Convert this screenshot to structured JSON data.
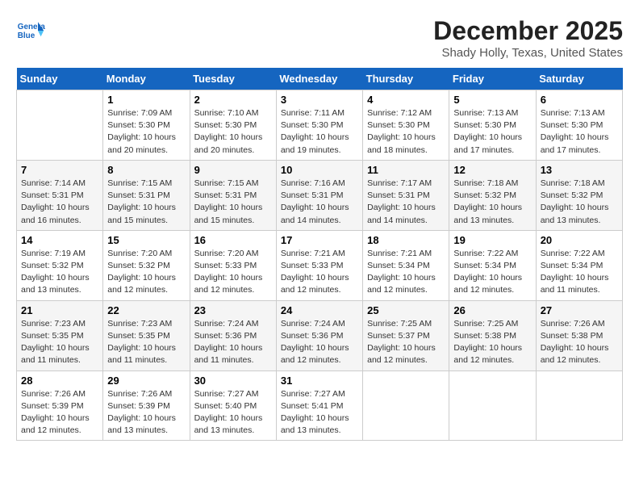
{
  "header": {
    "month": "December 2025",
    "location": "Shady Holly, Texas, United States"
  },
  "days_of_week": [
    "Sunday",
    "Monday",
    "Tuesday",
    "Wednesday",
    "Thursday",
    "Friday",
    "Saturday"
  ],
  "weeks": [
    [
      {
        "num": "",
        "info": ""
      },
      {
        "num": "1",
        "info": "Sunrise: 7:09 AM\nSunset: 5:30 PM\nDaylight: 10 hours\nand 20 minutes."
      },
      {
        "num": "2",
        "info": "Sunrise: 7:10 AM\nSunset: 5:30 PM\nDaylight: 10 hours\nand 20 minutes."
      },
      {
        "num": "3",
        "info": "Sunrise: 7:11 AM\nSunset: 5:30 PM\nDaylight: 10 hours\nand 19 minutes."
      },
      {
        "num": "4",
        "info": "Sunrise: 7:12 AM\nSunset: 5:30 PM\nDaylight: 10 hours\nand 18 minutes."
      },
      {
        "num": "5",
        "info": "Sunrise: 7:13 AM\nSunset: 5:30 PM\nDaylight: 10 hours\nand 17 minutes."
      },
      {
        "num": "6",
        "info": "Sunrise: 7:13 AM\nSunset: 5:30 PM\nDaylight: 10 hours\nand 17 minutes."
      }
    ],
    [
      {
        "num": "7",
        "info": "Sunrise: 7:14 AM\nSunset: 5:31 PM\nDaylight: 10 hours\nand 16 minutes."
      },
      {
        "num": "8",
        "info": "Sunrise: 7:15 AM\nSunset: 5:31 PM\nDaylight: 10 hours\nand 15 minutes."
      },
      {
        "num": "9",
        "info": "Sunrise: 7:15 AM\nSunset: 5:31 PM\nDaylight: 10 hours\nand 15 minutes."
      },
      {
        "num": "10",
        "info": "Sunrise: 7:16 AM\nSunset: 5:31 PM\nDaylight: 10 hours\nand 14 minutes."
      },
      {
        "num": "11",
        "info": "Sunrise: 7:17 AM\nSunset: 5:31 PM\nDaylight: 10 hours\nand 14 minutes."
      },
      {
        "num": "12",
        "info": "Sunrise: 7:18 AM\nSunset: 5:32 PM\nDaylight: 10 hours\nand 13 minutes."
      },
      {
        "num": "13",
        "info": "Sunrise: 7:18 AM\nSunset: 5:32 PM\nDaylight: 10 hours\nand 13 minutes."
      }
    ],
    [
      {
        "num": "14",
        "info": "Sunrise: 7:19 AM\nSunset: 5:32 PM\nDaylight: 10 hours\nand 13 minutes."
      },
      {
        "num": "15",
        "info": "Sunrise: 7:20 AM\nSunset: 5:32 PM\nDaylight: 10 hours\nand 12 minutes."
      },
      {
        "num": "16",
        "info": "Sunrise: 7:20 AM\nSunset: 5:33 PM\nDaylight: 10 hours\nand 12 minutes."
      },
      {
        "num": "17",
        "info": "Sunrise: 7:21 AM\nSunset: 5:33 PM\nDaylight: 10 hours\nand 12 minutes."
      },
      {
        "num": "18",
        "info": "Sunrise: 7:21 AM\nSunset: 5:34 PM\nDaylight: 10 hours\nand 12 minutes."
      },
      {
        "num": "19",
        "info": "Sunrise: 7:22 AM\nSunset: 5:34 PM\nDaylight: 10 hours\nand 12 minutes."
      },
      {
        "num": "20",
        "info": "Sunrise: 7:22 AM\nSunset: 5:34 PM\nDaylight: 10 hours\nand 11 minutes."
      }
    ],
    [
      {
        "num": "21",
        "info": "Sunrise: 7:23 AM\nSunset: 5:35 PM\nDaylight: 10 hours\nand 11 minutes."
      },
      {
        "num": "22",
        "info": "Sunrise: 7:23 AM\nSunset: 5:35 PM\nDaylight: 10 hours\nand 11 minutes."
      },
      {
        "num": "23",
        "info": "Sunrise: 7:24 AM\nSunset: 5:36 PM\nDaylight: 10 hours\nand 11 minutes."
      },
      {
        "num": "24",
        "info": "Sunrise: 7:24 AM\nSunset: 5:36 PM\nDaylight: 10 hours\nand 12 minutes."
      },
      {
        "num": "25",
        "info": "Sunrise: 7:25 AM\nSunset: 5:37 PM\nDaylight: 10 hours\nand 12 minutes."
      },
      {
        "num": "26",
        "info": "Sunrise: 7:25 AM\nSunset: 5:38 PM\nDaylight: 10 hours\nand 12 minutes."
      },
      {
        "num": "27",
        "info": "Sunrise: 7:26 AM\nSunset: 5:38 PM\nDaylight: 10 hours\nand 12 minutes."
      }
    ],
    [
      {
        "num": "28",
        "info": "Sunrise: 7:26 AM\nSunset: 5:39 PM\nDaylight: 10 hours\nand 12 minutes."
      },
      {
        "num": "29",
        "info": "Sunrise: 7:26 AM\nSunset: 5:39 PM\nDaylight: 10 hours\nand 13 minutes."
      },
      {
        "num": "30",
        "info": "Sunrise: 7:27 AM\nSunset: 5:40 PM\nDaylight: 10 hours\nand 13 minutes."
      },
      {
        "num": "31",
        "info": "Sunrise: 7:27 AM\nSunset: 5:41 PM\nDaylight: 10 hours\nand 13 minutes."
      },
      {
        "num": "",
        "info": ""
      },
      {
        "num": "",
        "info": ""
      },
      {
        "num": "",
        "info": ""
      }
    ]
  ]
}
